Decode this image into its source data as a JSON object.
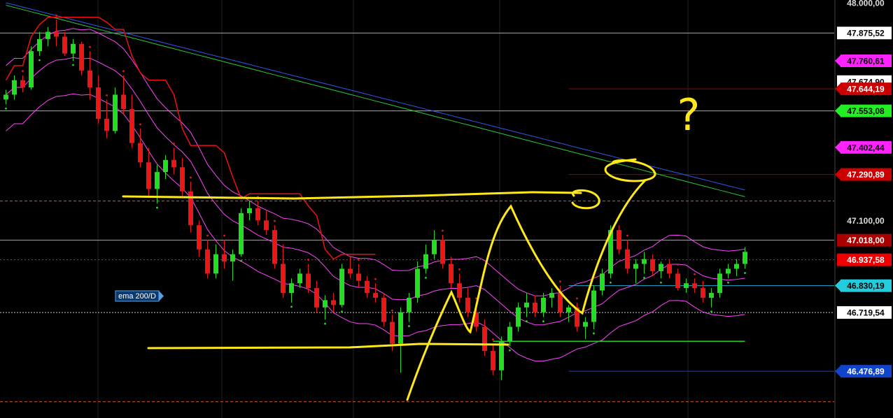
{
  "chart_data": {
    "type": "candlestick",
    "title": "",
    "ylim": [
      46300,
      48000
    ],
    "colors": {
      "background": "#000000",
      "bull": "#22dd22",
      "bear": "#e81818",
      "grid": "#222222",
      "support_resistance": "#dd4422",
      "annotation": "#ffe81a",
      "sma_upper": "#ff44ff",
      "sma_lower": "#ff44ff",
      "ema_blue": "#3355ee",
      "ema_green": "#22cc33",
      "stop_red": "#ee1111",
      "stop_green": "#22cc22"
    },
    "candles": [
      [
        0,
        47600,
        47640,
        47580,
        47620
      ],
      [
        1,
        47620,
        47700,
        47600,
        47680
      ],
      [
        2,
        47680,
        47700,
        47630,
        47650
      ],
      [
        3,
        47650,
        47820,
        47640,
        47800
      ],
      [
        4,
        47800,
        47880,
        47780,
        47850
      ],
      [
        5,
        47850,
        47900,
        47820,
        47880
      ],
      [
        6,
        47880,
        47930,
        47820,
        47860
      ],
      [
        7,
        47860,
        47880,
        47780,
        47790
      ],
      [
        8,
        47790,
        47850,
        47760,
        47830
      ],
      [
        9,
        47830,
        47840,
        47700,
        47720
      ],
      [
        10,
        47720,
        47800,
        47600,
        47650
      ],
      [
        11,
        47650,
        47700,
        47500,
        47520
      ],
      [
        12,
        47520,
        47600,
        47440,
        47470
      ],
      [
        13,
        47470,
        47650,
        47460,
        47620
      ],
      [
        14,
        47620,
        47700,
        47540,
        47560
      ],
      [
        15,
        47560,
        47620,
        47400,
        47420
      ],
      [
        16,
        47420,
        47480,
        47320,
        47340
      ],
      [
        17,
        47340,
        47400,
        47200,
        47230
      ],
      [
        18,
        47230,
        47330,
        47170,
        47300
      ],
      [
        19,
        47300,
        47370,
        47270,
        47350
      ],
      [
        20,
        47350,
        47400,
        47290,
        47320
      ],
      [
        21,
        47320,
        47360,
        47200,
        47220
      ],
      [
        22,
        47220,
        47260,
        47050,
        47080
      ],
      [
        23,
        47080,
        47100,
        46950,
        46980
      ],
      [
        24,
        46980,
        47020,
        46860,
        46880
      ],
      [
        25,
        46880,
        47000,
        46860,
        46960
      ],
      [
        26,
        46960,
        47020,
        46900,
        46930
      ],
      [
        27,
        46930,
        46980,
        46850,
        46960
      ],
      [
        28,
        46960,
        47150,
        46950,
        47130
      ],
      [
        29,
        47130,
        47180,
        47100,
        47150
      ],
      [
        30,
        47150,
        47180,
        47080,
        47100
      ],
      [
        31,
        47100,
        47140,
        47040,
        47060
      ],
      [
        32,
        47060,
        47080,
        46900,
        46920
      ],
      [
        33,
        46920,
        47000,
        46780,
        46800
      ],
      [
        34,
        46800,
        46860,
        46760,
        46840
      ],
      [
        35,
        46840,
        46900,
        46820,
        46880
      ],
      [
        36,
        46880,
        46920,
        46800,
        46820
      ],
      [
        37,
        46820,
        46850,
        46720,
        46740
      ],
      [
        38,
        46740,
        46790,
        46690,
        46770
      ],
      [
        39,
        46770,
        46800,
        46720,
        46750
      ],
      [
        40,
        46750,
        46920,
        46740,
        46900
      ],
      [
        41,
        46900,
        46950,
        46860,
        46880
      ],
      [
        42,
        46880,
        46920,
        46820,
        46850
      ],
      [
        43,
        46850,
        46870,
        46780,
        46800
      ],
      [
        44,
        46800,
        46840,
        46760,
        46780
      ],
      [
        45,
        46780,
        46800,
        46660,
        46680
      ],
      [
        46,
        46680,
        46710,
        46560,
        46590
      ],
      [
        47,
        46590,
        46740,
        46470,
        46720
      ],
      [
        48,
        46720,
        46800,
        46680,
        46780
      ],
      [
        49,
        46780,
        46930,
        46760,
        46900
      ],
      [
        50,
        46900,
        47000,
        46880,
        46960
      ],
      [
        51,
        46960,
        47060,
        46940,
        47020
      ],
      [
        52,
        47020,
        47040,
        46900,
        46920
      ],
      [
        53,
        46920,
        46950,
        46820,
        46840
      ],
      [
        54,
        46840,
        46880,
        46760,
        46780
      ],
      [
        55,
        46780,
        46820,
        46700,
        46720
      ],
      [
        56,
        46720,
        46760,
        46640,
        46660
      ],
      [
        57,
        46660,
        46690,
        46540,
        46560
      ],
      [
        58,
        46560,
        46590,
        46460,
        46480
      ],
      [
        59,
        46480,
        46620,
        46440,
        46600
      ],
      [
        60,
        46600,
        46680,
        46580,
        46660
      ],
      [
        61,
        46660,
        46760,
        46640,
        46740
      ],
      [
        62,
        46740,
        46800,
        46700,
        46760
      ],
      [
        63,
        46760,
        46790,
        46700,
        46720
      ],
      [
        64,
        46720,
        46800,
        46700,
        46780
      ],
      [
        65,
        46780,
        46820,
        46740,
        46800
      ],
      [
        66,
        46800,
        46830,
        46700,
        46720
      ],
      [
        67,
        46720,
        46750,
        46680,
        46740
      ],
      [
        68,
        46740,
        46760,
        46640,
        46660
      ],
      [
        69,
        46660,
        46700,
        46610,
        46680
      ],
      [
        70,
        46680,
        46830,
        46650,
        46810
      ],
      [
        71,
        46810,
        46900,
        46790,
        46880
      ],
      [
        72,
        46880,
        47080,
        46860,
        47060
      ],
      [
        73,
        47060,
        47080,
        46960,
        46980
      ],
      [
        74,
        46980,
        47020,
        46880,
        46900
      ],
      [
        75,
        46900,
        46940,
        46840,
        46920
      ],
      [
        76,
        46920,
        46970,
        46880,
        46940
      ],
      [
        77,
        46940,
        46960,
        46870,
        46890
      ],
      [
        78,
        46890,
        46930,
        46860,
        46920
      ],
      [
        79,
        46920,
        46940,
        46860,
        46880
      ],
      [
        80,
        46880,
        46900,
        46810,
        46820
      ],
      [
        81,
        46820,
        46860,
        46800,
        46840
      ],
      [
        82,
        46840,
        46860,
        46800,
        46820
      ],
      [
        83,
        46820,
        46850,
        46760,
        46780
      ],
      [
        84,
        46780,
        46820,
        46740,
        46800
      ],
      [
        85,
        46800,
        46900,
        46780,
        46880
      ],
      [
        86,
        46880,
        46920,
        46860,
        46900
      ],
      [
        87,
        46900,
        46940,
        46870,
        46920
      ],
      [
        88,
        46920,
        46990,
        46900,
        46970
      ]
    ],
    "price_labels": [
      {
        "text": "48.000,00",
        "price": 48000,
        "bg": "",
        "fg": "#dddddd",
        "arrow": false
      },
      {
        "text": "47.875,52",
        "price": 47875,
        "bg": "#ffffff",
        "fg": "#000000",
        "arrow": false
      },
      {
        "text": "47.760,61",
        "price": 47760,
        "bg": "#ff22ff",
        "fg": "#000000",
        "arrow": true
      },
      {
        "text": "47.674,90",
        "price": 47674,
        "bg": "#ffffff",
        "fg": "#000000",
        "arrow": false
      },
      {
        "text": "47.644,19",
        "price": 47644,
        "bg": "#cc0000",
        "fg": "#ffffff",
        "arrow": true
      },
      {
        "text": "47.553,08",
        "price": 47553,
        "bg": "#22ee22",
        "fg": "#000000",
        "arrow": true
      },
      {
        "text": "47.402,44",
        "price": 47402,
        "bg": "#ff22ff",
        "fg": "#000000",
        "arrow": true
      },
      {
        "text": "47.290,89",
        "price": 47290,
        "bg": "#cc0000",
        "fg": "#ffffff",
        "arrow": true
      },
      {
        "text": "47.100,00",
        "price": 47100,
        "bg": "",
        "fg": "#dddddd",
        "arrow": false
      },
      {
        "text": "47.018,00",
        "price": 47018,
        "bg": "#aa0000",
        "fg": "#ffffff",
        "arrow": false
      },
      {
        "text": "46.937,58",
        "price": 46937,
        "bg": "#ee0000",
        "fg": "#ffffff",
        "arrow": false
      },
      {
        "text": "46.830,19",
        "price": 46830,
        "bg": "#22ccdd",
        "fg": "#000000",
        "arrow": true
      },
      {
        "text": "46.719,54",
        "price": 46719,
        "bg": "#ffffff",
        "fg": "#000000",
        "arrow": false
      },
      {
        "text": "46.476,89",
        "price": 46476,
        "bg": "#1144cc",
        "fg": "#ffffff",
        "arrow": true
      }
    ],
    "horizontal_levels": [
      {
        "price": 47875,
        "color": "#aaaaaa",
        "dash": "none"
      },
      {
        "price": 47644,
        "color": "#990000",
        "dash": "none",
        "from_candle": 67
      },
      {
        "price": 47553,
        "color": "#aaaaaa",
        "dash": "none"
      },
      {
        "price": 47290,
        "color": "#990000",
        "dash": "none",
        "from_candle": 67
      },
      {
        "price": 47018,
        "color": "#aaaaaa",
        "dash": "none"
      },
      {
        "price": 46937,
        "color": "#cc3322",
        "dash": "2,3"
      },
      {
        "price": 46830,
        "color": "#22aacc",
        "dash": "none",
        "from_candle": 67
      },
      {
        "price": 46719,
        "color": "#cccccc",
        "dash": "2,2"
      },
      {
        "price": 46476,
        "color": "#1144cc",
        "dash": "none",
        "from_candle": 67
      },
      {
        "price": 47180,
        "color": "#dd5533",
        "dash": "4,3"
      },
      {
        "price": 46350,
        "color": "#dd5533",
        "dash": "4,3"
      }
    ],
    "ema_label": "ema 200/D",
    "ema_label_price": 46820,
    "question_mark": "?"
  }
}
